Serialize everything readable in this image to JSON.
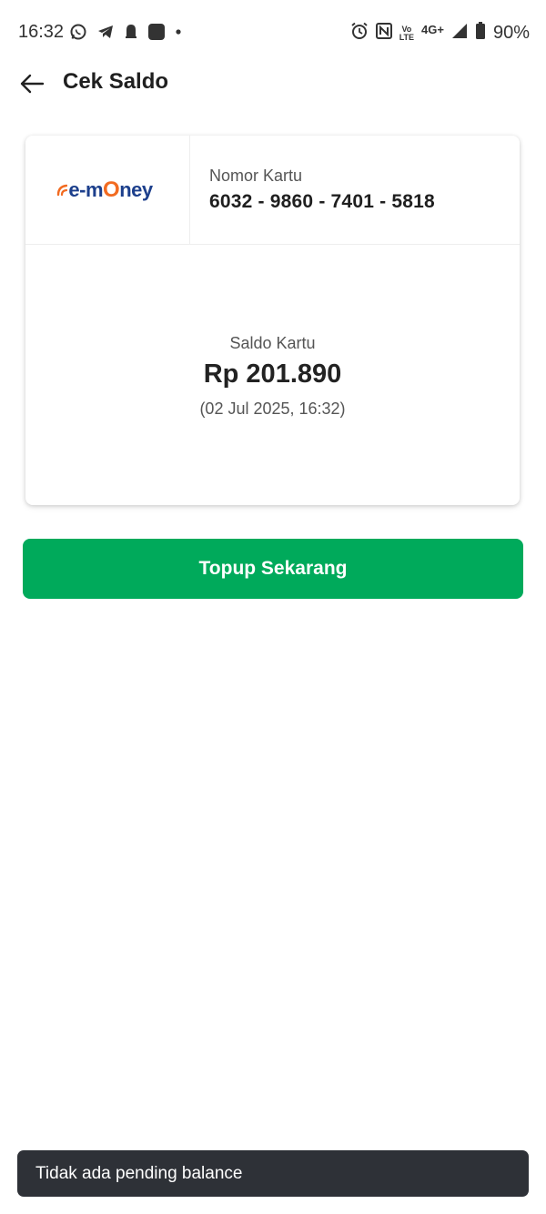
{
  "status_bar": {
    "time": "16:32",
    "left_icons": [
      "whatsapp-icon",
      "telegram-icon",
      "notification-bell-icon",
      "app-square-icon",
      "dot-icon"
    ],
    "right_icons": [
      "alarm-icon",
      "nfc-icon",
      "volte-icon",
      "signal-icon",
      "battery-icon"
    ],
    "volte_top": "Vo",
    "volte_bottom": "LTE",
    "network": "4G+",
    "battery": "90%"
  },
  "header": {
    "title": "Cek Saldo",
    "back_icon": "arrow-left-icon"
  },
  "card": {
    "logo": {
      "prefix": "e-m",
      "o": "O",
      "suffix": "ney",
      "accent_color": "#f26b21",
      "brand_color": "#1c3f8c"
    },
    "number_label": "Nomor Kartu",
    "number": "6032 - 9860 - 7401 - 5818",
    "balance_label": "Saldo Kartu",
    "balance": "Rp 201.890",
    "balance_time": "(02 Jul 2025, 16:32)"
  },
  "actions": {
    "topup_label": "Topup Sekarang",
    "topup_color": "#00aa5b"
  },
  "snackbar": {
    "message": "Tidak ada pending balance"
  }
}
